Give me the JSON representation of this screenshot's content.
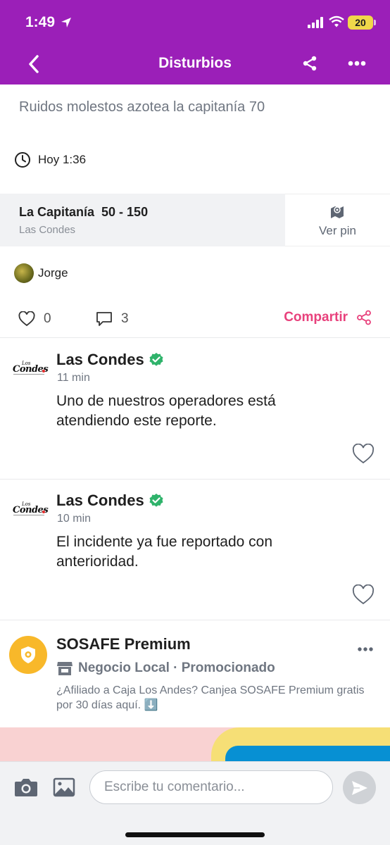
{
  "status_bar": {
    "time": "1:49",
    "battery": "20"
  },
  "nav": {
    "title": "Disturbios"
  },
  "report": {
    "headline": "Ruidos molestos azotea la capitanía 70",
    "time": "Hoy 1:36",
    "address_main": "La Capitanía  50 - 150",
    "address_sub": "Las Condes",
    "pin_label": "Ver pin",
    "author": "Jorge",
    "likes": "0",
    "comments": "3",
    "share_label": "Compartir"
  },
  "comments": [
    {
      "author": "Las Condes",
      "time": "11 min",
      "text": "Uno de nuestros operadores está atendiendo este reporte.",
      "logo_top": "Los",
      "logo_main": "Condes"
    },
    {
      "author": "Las Condes",
      "time": "10 min",
      "text": "El incidente ya fue reportado con anterioridad.",
      "logo_top": "Los",
      "logo_main": "Condes"
    }
  ],
  "promo": {
    "title": "SOSAFE Premium",
    "subtitle": "Negocio Local · Promocionado",
    "description": "¿Afiliado a Caja Los Andes? Canjea SOSAFE Premium gratis por 30 días aquí. ⬇️"
  },
  "composer": {
    "placeholder": "Escribe tu comentario..."
  },
  "colors": {
    "header": "#9b1fb8",
    "accent": "#e8417c",
    "verified": "#2fb36b",
    "promo_badge": "#f8b82a"
  },
  "icons": [
    "back-icon",
    "share-icon",
    "more-icon",
    "clock-icon",
    "map-icon",
    "heart-icon",
    "comment-icon",
    "verified-icon",
    "store-icon",
    "camera-icon",
    "gallery-icon",
    "send-icon"
  ]
}
